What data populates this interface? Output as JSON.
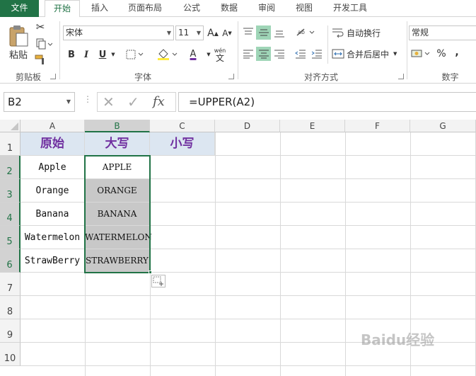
{
  "tabs": [
    "文件",
    "开始",
    "插入",
    "页面布局",
    "公式",
    "数据",
    "审阅",
    "视图",
    "开发工具"
  ],
  "ribbon": {
    "clipboard": {
      "paste_label": "粘贴",
      "group_label": "剪贴板"
    },
    "font": {
      "font_name": "宋体",
      "font_size": "11",
      "group_label": "字体",
      "bold": "B",
      "italic": "I",
      "underline": "U",
      "grow": "A",
      "shrink": "A",
      "font_color": "A",
      "wen": "wén",
      "wen_char": "文"
    },
    "alignment": {
      "wrap_text": "自动换行",
      "merge_center": "合并后居中",
      "group_label": "对齐方式"
    },
    "number": {
      "format": "常规",
      "percent": "%",
      "comma": ",",
      "group_label": "数字"
    }
  },
  "formula_bar": {
    "name_box": "B2",
    "fx": "fx",
    "formula": "=UPPER(A2)"
  },
  "columns": [
    "A",
    "B",
    "C",
    "D",
    "E",
    "F",
    "G"
  ],
  "rows": [
    "1",
    "2",
    "3",
    "4",
    "5",
    "6",
    "7",
    "8",
    "9",
    "10"
  ],
  "cells": {
    "A1": "原始",
    "B1": "大写",
    "C1": "小写",
    "A2": "Apple",
    "B2": "APPLE",
    "A3": "Orange",
    "B3": "ORANGE",
    "A4": "Banana",
    "B4": "BANANA",
    "A5": "Watermelon",
    "B5": "WATERMELON",
    "A6": "StrawBerry",
    "B6": "STRAWBERRY"
  },
  "watermark": "Baidu经验",
  "colors": {
    "excel_green": "#217346",
    "header_fill": "#dce6f1",
    "header_text": "#7030a0",
    "selection_fill": "#c8c8c8"
  }
}
